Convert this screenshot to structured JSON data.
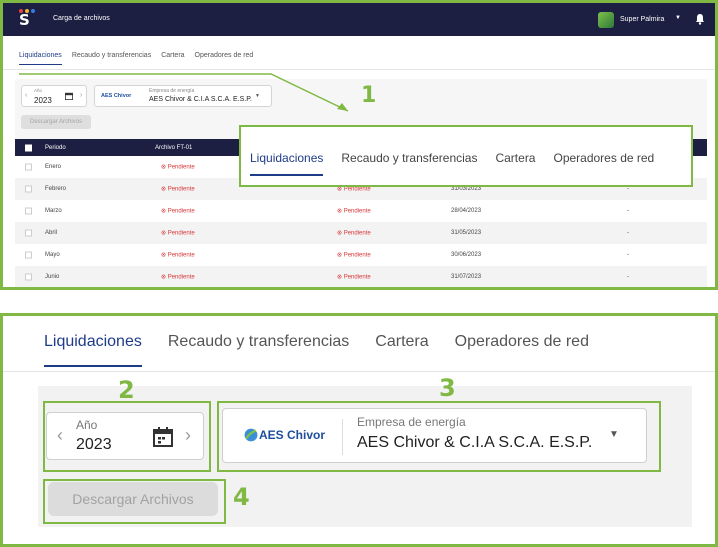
{
  "app": {
    "title": "Carga de archivos",
    "user_name": "Super Palmira",
    "logo_colors": [
      "#e8443a",
      "#f2b632",
      "#3b7be0",
      "#3fb55a"
    ]
  },
  "tabs": [
    "Liquidaciones",
    "Recaudo y transferencias",
    "Cartera",
    "Operadores de red"
  ],
  "active_tab": "Liquidaciones",
  "filters": {
    "year_label": "Año",
    "year_value": "2023",
    "company_label": "Empresa de energía",
    "company_value": "AES Chivor & C.I.A S.C.A. E.S.P.",
    "company_logo_text": "AES Chivor",
    "download_button": "Descargar Archivos"
  },
  "table": {
    "headers": [
      "Periodo",
      "Archivo FT-01"
    ],
    "rows": [
      {
        "period": "Enero",
        "status1": "Pendiente",
        "status2": "",
        "date": "",
        "dash": ""
      },
      {
        "period": "Febrero",
        "status1": "Pendiente",
        "status2": "Pendiente",
        "date": "31/03/2023",
        "dash": "-"
      },
      {
        "period": "Marzo",
        "status1": "Pendiente",
        "status2": "Pendiente",
        "date": "28/04/2023",
        "dash": "-"
      },
      {
        "period": "Abril",
        "status1": "Pendiente",
        "status2": "Pendiente",
        "date": "31/05/2023",
        "dash": "-"
      },
      {
        "period": "Mayo",
        "status1": "Pendiente",
        "status2": "Pendiente",
        "date": "30/06/2023",
        "dash": "-"
      },
      {
        "period": "Junio",
        "status1": "Pendiente",
        "status2": "Pendiente",
        "date": "31/07/2023",
        "dash": "-"
      }
    ]
  },
  "annotations": {
    "step1": "1",
    "step2": "2",
    "step3": "3",
    "step4": "4"
  },
  "colors": {
    "accent": "#7fb842",
    "navy": "#1c1e42",
    "tab_active": "#1f3c88",
    "pending": "#d9383a"
  }
}
